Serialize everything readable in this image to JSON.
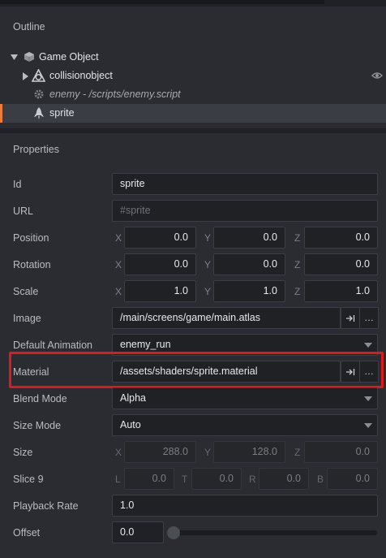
{
  "outline": {
    "title": "Outline",
    "items": [
      {
        "label": "Game Object",
        "icon": "game-object-cube-icon"
      },
      {
        "label": "collisionobject",
        "icon": "collision-object-icon"
      },
      {
        "label": "enemy - /scripts/enemy.script",
        "icon": "script-gear-icon"
      },
      {
        "label": "sprite",
        "icon": "sprite-rocket-icon"
      }
    ]
  },
  "properties": {
    "title": "Properties",
    "id": {
      "label": "Id",
      "value": "sprite"
    },
    "url": {
      "label": "URL",
      "placeholder": "#sprite"
    },
    "position": {
      "label": "Position",
      "x": "0.0",
      "y": "0.0",
      "z": "0.0"
    },
    "rotation": {
      "label": "Rotation",
      "x": "0.0",
      "y": "0.0",
      "z": "0.0"
    },
    "scale": {
      "label": "Scale",
      "x": "1.0",
      "y": "1.0",
      "z": "1.0"
    },
    "image": {
      "label": "Image",
      "value": "/main/screens/game/main.atlas"
    },
    "default_animation": {
      "label": "Default Animation",
      "value": "enemy_run"
    },
    "material": {
      "label": "Material",
      "value": "/assets/shaders/sprite.material"
    },
    "blend_mode": {
      "label": "Blend Mode",
      "value": "Alpha"
    },
    "size_mode": {
      "label": "Size Mode",
      "value": "Auto"
    },
    "size": {
      "label": "Size",
      "x": "288.0",
      "y": "128.0",
      "z": "0.0"
    },
    "slice9": {
      "label": "Slice 9",
      "l": "0.0",
      "t": "0.0",
      "r": "0.0",
      "b": "0.0"
    },
    "playback_rate": {
      "label": "Playback Rate",
      "value": "1.0"
    },
    "offset": {
      "label": "Offset",
      "value": "0.0",
      "level": 0.0
    }
  },
  "axes": {
    "x": "X",
    "y": "Y",
    "z": "Z",
    "l": "L",
    "t": "T",
    "r": "R",
    "b": "B"
  },
  "colors": {
    "accent": "#f07a3a",
    "highlight_box": "#e01a1a"
  }
}
